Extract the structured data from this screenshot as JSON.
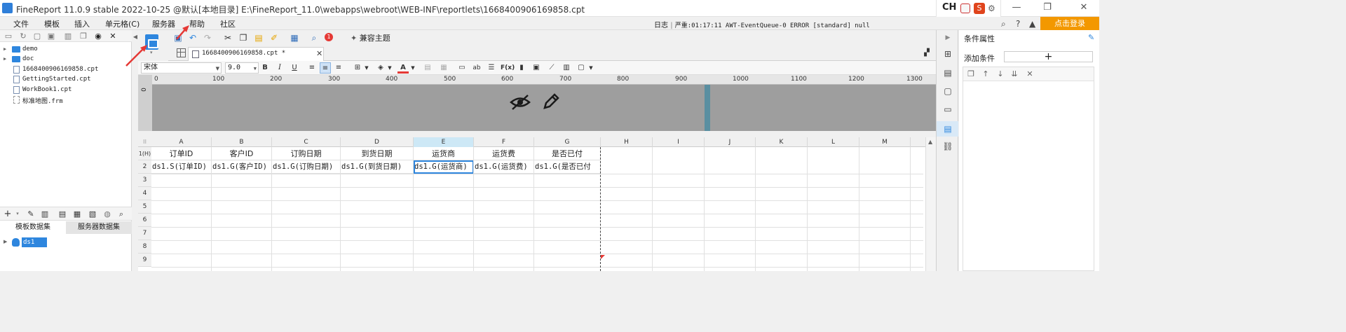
{
  "window": {
    "title": "FineReport 11.0.9 stable 2022-10-25 @默认[本地目录]   E:\\FineReport_11.0\\webapps\\webroot\\WEB-INF\\reportlets\\1668400906169858.cpt",
    "ime": {
      "lang": "CH",
      "sogou": "S",
      "gear": "⚙"
    },
    "controls": {
      "minimize": "—",
      "restore": "❐",
      "close": "✕"
    }
  },
  "menu": {
    "items": [
      "文件",
      "模板",
      "插入",
      "单元格(C)",
      "服务器",
      "帮助",
      "社区"
    ],
    "log_label": "日志",
    "log_text": "严重:01:17:11 AWT-EventQueue-0 ERROR [standard] null",
    "login_button": "点击登录"
  },
  "left_panel": {
    "tree": [
      {
        "label": "demo",
        "type": "folder"
      },
      {
        "label": "doc",
        "type": "folder"
      },
      {
        "label": "1668400906169858.cpt",
        "type": "file"
      },
      {
        "label": "GettingStarted.cpt",
        "type": "file"
      },
      {
        "label": "WorkBook1.cpt",
        "type": "file"
      },
      {
        "label": "标准地图.frm",
        "type": "frm"
      }
    ],
    "tabs": [
      "模板数据集",
      "服务器数据集"
    ],
    "datasets": [
      "ds1"
    ]
  },
  "toolbar": {
    "compat_theme": "兼容主题",
    "badge": "1",
    "file_tab": "1668400906169858.cpt *",
    "font_name": "宋体",
    "font_size": "9.0"
  },
  "ruler": {
    "marks": [
      "0",
      "100",
      "200",
      "300",
      "400",
      "500",
      "600",
      "700",
      "800",
      "900",
      "1000",
      "1100",
      "1200",
      "1300"
    ],
    "left_mark": "0"
  },
  "sheet": {
    "corner": "1(H)",
    "columns": [
      "A",
      "B",
      "C",
      "D",
      "E",
      "F",
      "G",
      "H",
      "I",
      "J",
      "K",
      "L",
      "M"
    ],
    "selected_column": "E",
    "rows": [
      "2",
      "3",
      "4",
      "5",
      "6",
      "7",
      "8",
      "9"
    ],
    "header_row": [
      "订单ID",
      "客户ID",
      "订购日期",
      "到货日期",
      "运货商",
      "运货费",
      "是否已付"
    ],
    "data_row": [
      "ds1.S(订单ID)",
      "ds1.G(客户ID)",
      "ds1.G(订购日期)",
      "ds1.G(到货日期)",
      "ds1.G(运货商)",
      "ds1.G(运货费)",
      "ds1.G(是否已付"
    ]
  },
  "right_panel": {
    "title": "条件属性",
    "add_label": "添加条件",
    "add_button": "+"
  },
  "colors": {
    "accent": "#2e86de",
    "login": "#f39800",
    "badge": "#e53935"
  }
}
